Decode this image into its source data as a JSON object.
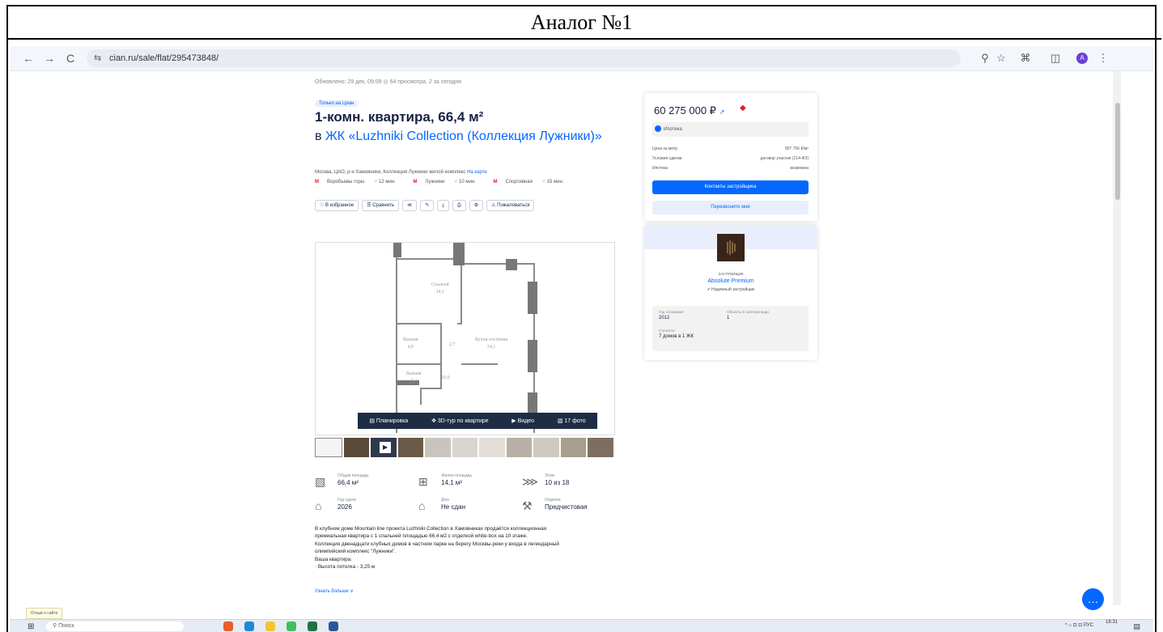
{
  "doc_title": "Аналог №1",
  "browser": {
    "url": "cian.ru/sale/flat/295473848/",
    "back_glyph": "←",
    "forward_glyph": "→",
    "reload_glyph": "C",
    "site_glyph": "⇆",
    "profile_letter": "A"
  },
  "listing": {
    "meta": "Обновлено: 29 дек, 09:09   ◎ 64 просмотра, 2 за сегодня",
    "tag": "Только на Циан",
    "title": "1-комн. квартира, 66,4 м²",
    "complex_prefix": "в",
    "complex_name": "ЖК «Luzhniki Collection (Коллекция Лужники)»",
    "address": "Москва, ЦАО, р-н Хамовники, Коллекция Лужники жилой комплекс",
    "address_link": "На карте",
    "metro": [
      {
        "name": "Воробьевы горы",
        "time": "12 мин."
      },
      {
        "name": "Лужники",
        "time": "10 мин."
      },
      {
        "name": "Спортивная",
        "time": "15 мин."
      }
    ],
    "actions": [
      "♡ В избранное",
      "☰ Сравнить",
      "≪",
      "✎",
      "⤓",
      "⎙",
      "⚙",
      "⚠ Пожаловаться"
    ],
    "floorplan_rooms": [
      {
        "label": "Спальня",
        "value": "14,1"
      },
      {
        "label": "Ванная",
        "value": "4,0"
      },
      {
        "label": "Кухня-гостиная",
        "value": "24,1"
      },
      {
        "label": "Ванная",
        "value": "2,4"
      },
      {
        "label": "",
        "value": "2,7"
      },
      {
        "label": "",
        "value": "10,0"
      }
    ],
    "media": [
      "▤ Планировка",
      "✥ 3D-тур по квартире",
      "▶ Видео",
      "▧ 17 фото"
    ],
    "params": [
      {
        "label": "Общая площадь",
        "value": "66,4 м²",
        "icon": "▧"
      },
      {
        "label": "Жилая площадь",
        "value": "14,1 м²",
        "icon": "⊞"
      },
      {
        "label": "Этаж",
        "value": "10 из 18",
        "icon": "⋙"
      },
      {
        "label": "Год сдачи",
        "value": "2026",
        "icon": "⌂"
      },
      {
        "label": "Дом",
        "value": "Не сдан",
        "icon": "⌂"
      },
      {
        "label": "Отделка",
        "value": "Предчистовая",
        "icon": "⚒"
      }
    ],
    "description": [
      "В клубном доме Mountain line проекта Luzhniki Collection в Хамовниках продаётся коллекционная",
      "премиальная квартира с 1 спальней площадью 66,4 м2 с отделкой white-box на 10 этаже.",
      "Коллекция двенадцати клубных домов в частном парке на берегу Москвы-реки у входа в легендарный",
      "олимпийский комплекс \"Лужники\".",
      "Ваша квартира:",
      "·    Высота потолка - 3,25 м"
    ],
    "more": "Узнать больше  ∨"
  },
  "price_card": {
    "price": "60 275 000 ₽",
    "price_trend": "↗",
    "mortgage": "Ипотека",
    "rows": [
      {
        "k": "Цена за метр",
        "v": "907 756 ₽/м²"
      },
      {
        "k": "Условия сделки",
        "v": "договор участия (214-ФЗ)"
      },
      {
        "k": "Ипотека",
        "v": "возможна"
      }
    ],
    "btn_contacts": "Контакты застройщика",
    "btn_call": "Перезвоните мне"
  },
  "developer": {
    "caption": "ЗАСТРОЙЩИК",
    "name": "Absolute Premium",
    "reliable": "Надежный застройщик",
    "stats": [
      {
        "k": "Год основания",
        "v": "2012"
      },
      {
        "k": "Объекты в эксплуатации",
        "v": "1"
      },
      {
        "k": "Строится",
        "v": "7 домов в 1 ЖК"
      }
    ]
  },
  "feedback": "Отзыв о сайте",
  "taskbar": {
    "start_glyph": "⊞",
    "search": "Поиск",
    "tray": "^ ⌂ ⊡ ⊡ РУС",
    "time": "18:31",
    "notif_glyph": "▤"
  },
  "colors": {
    "accent": "#0468ff",
    "metro": "#e31e24",
    "dark_text": "#152242"
  }
}
